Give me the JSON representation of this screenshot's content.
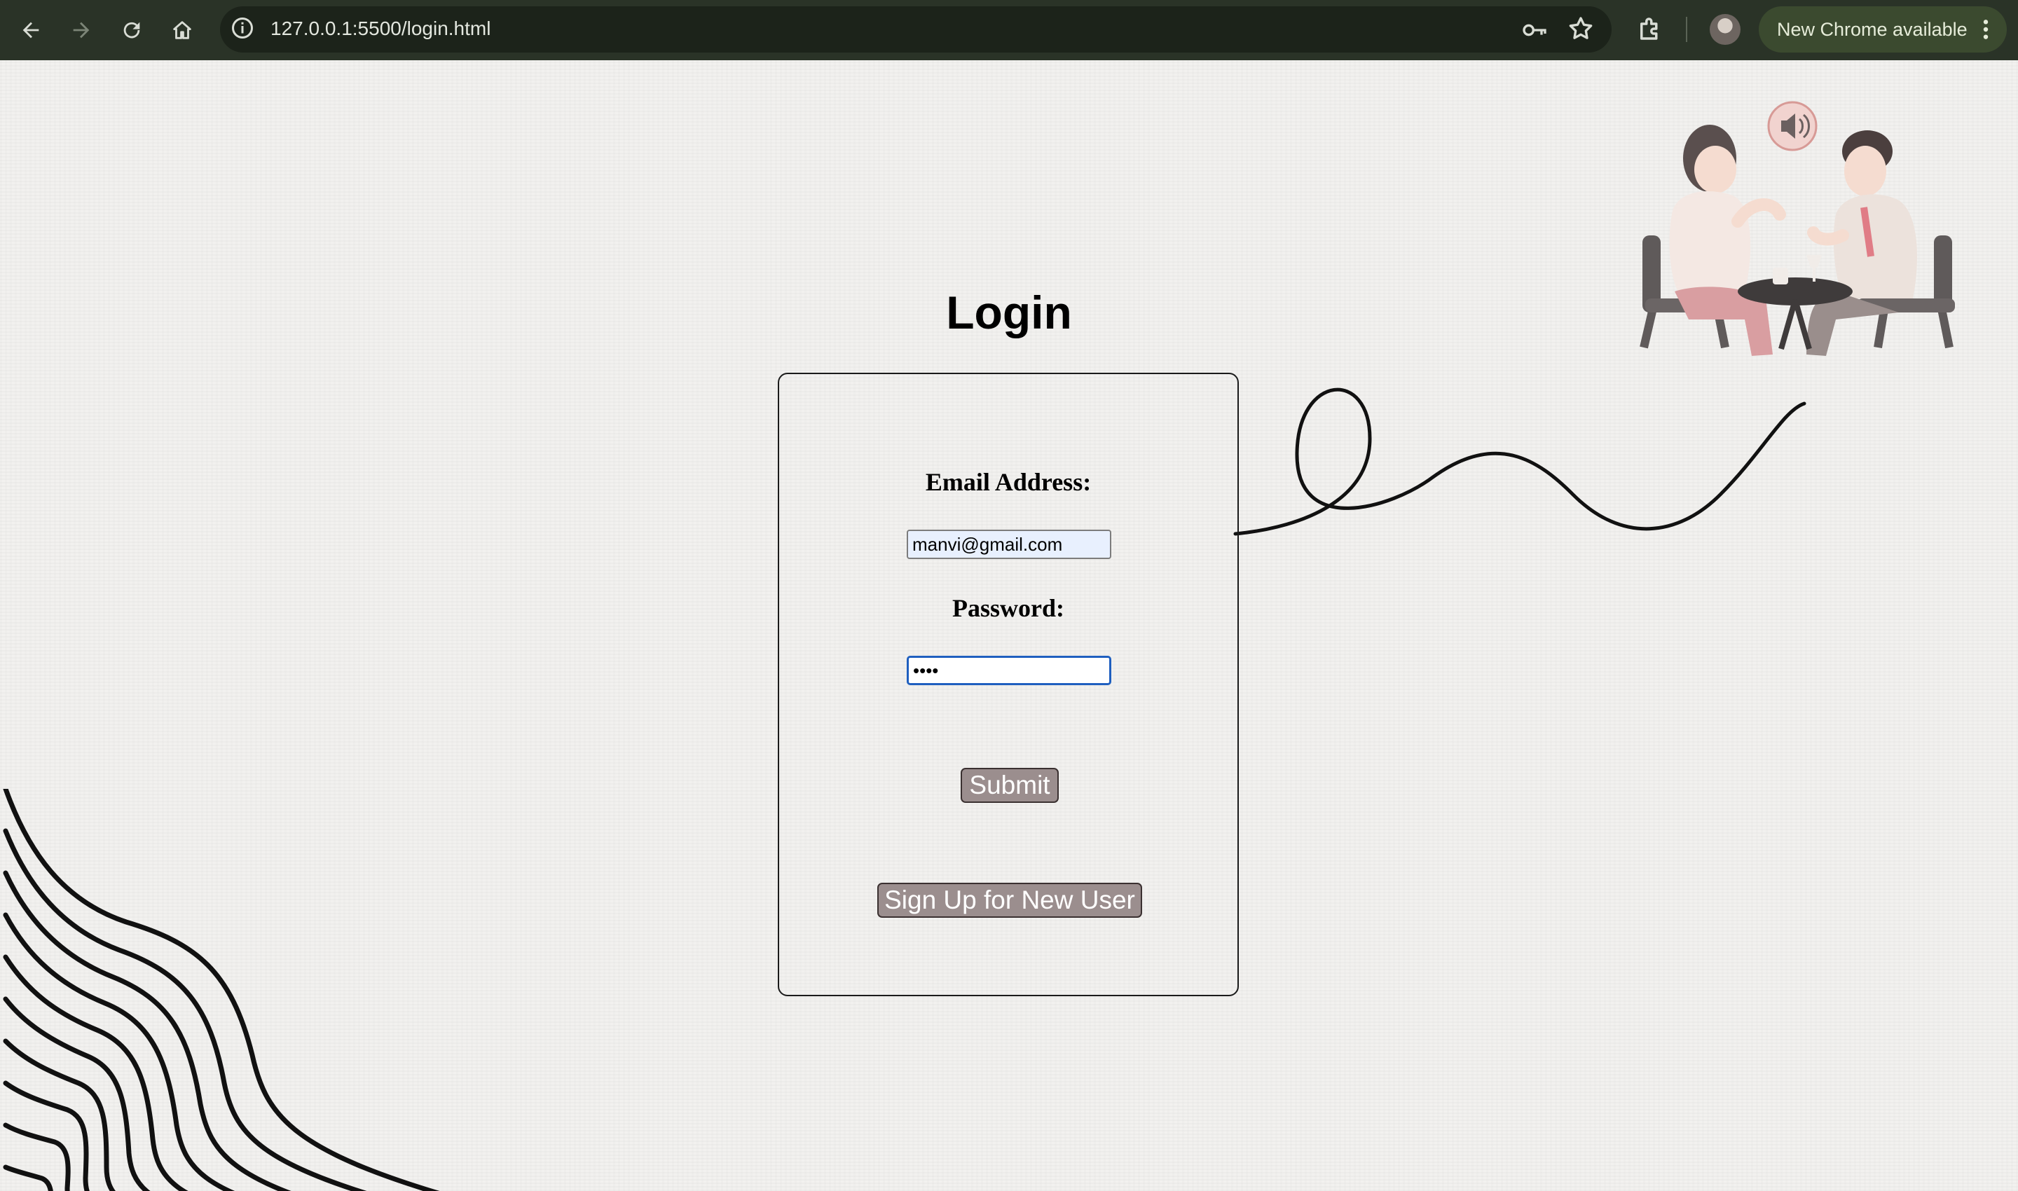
{
  "browser": {
    "url": "127.0.0.1:5500/login.html",
    "update_label": "New Chrome available",
    "toolbar_color": "#2a3327",
    "icons": [
      "back-icon",
      "forward-icon",
      "reload-icon",
      "home-icon",
      "site-info-icon",
      "password-key-icon",
      "bookmark-star-icon",
      "extensions-icon",
      "profile-avatar",
      "more-vert-icon"
    ]
  },
  "page": {
    "title": "Login",
    "email_label": "Email Address:",
    "email_value": "manvi@gmail.com",
    "password_label": "Password:",
    "password_value": "••••",
    "submit_label": "Submit",
    "signup_label": "Sign Up for New User",
    "button_color": "#9b8e8e"
  }
}
